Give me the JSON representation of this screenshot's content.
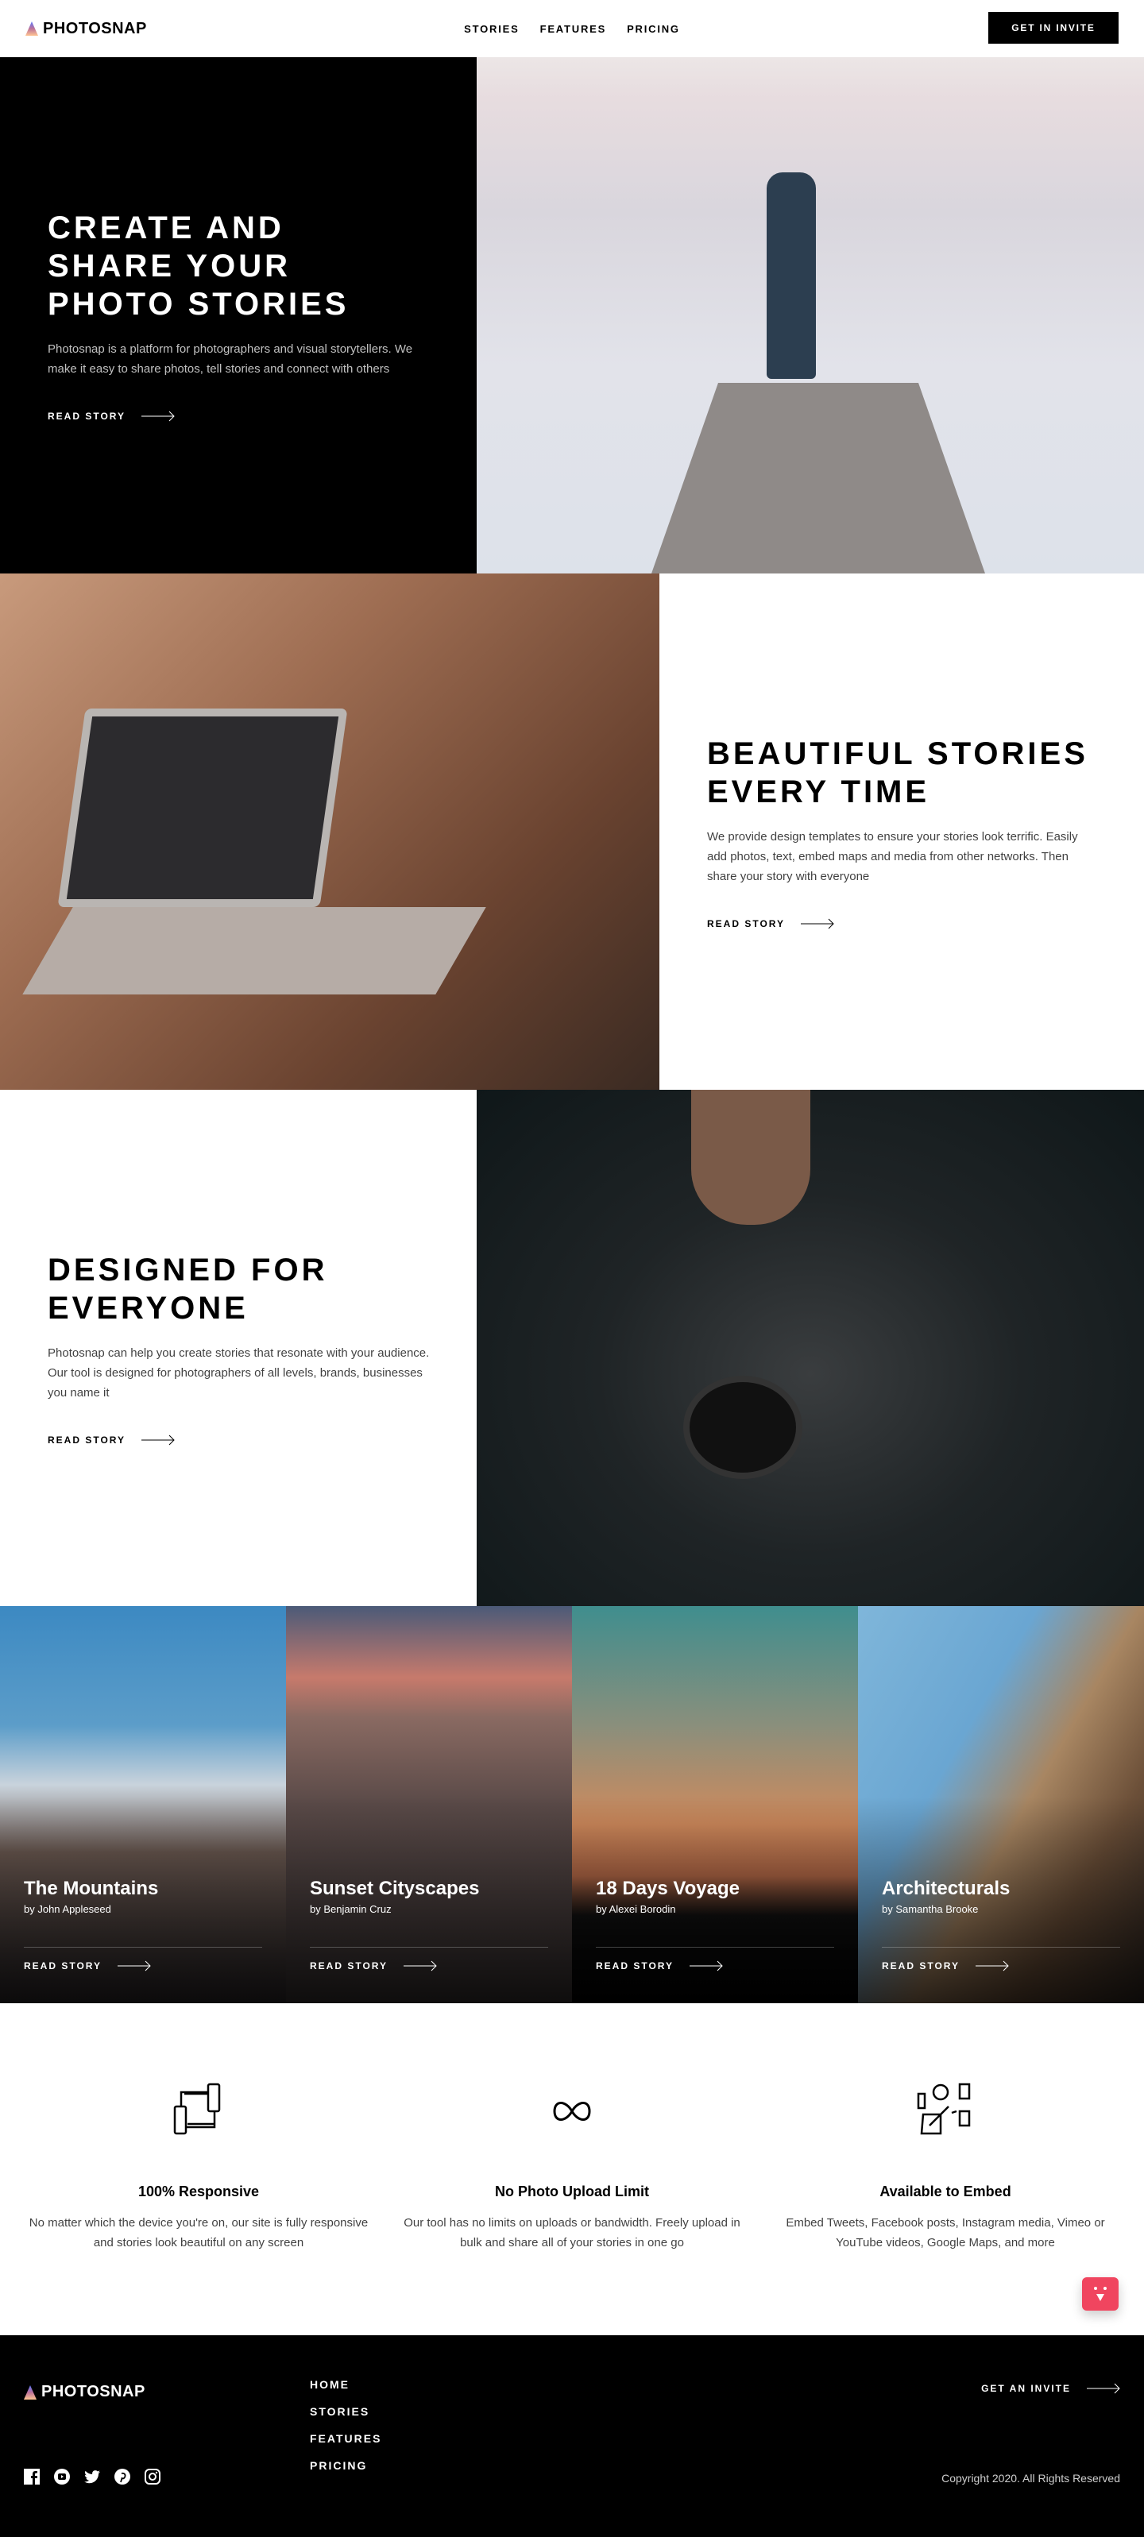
{
  "brand": "PHOTOSNAP",
  "nav": {
    "items": [
      "STORIES",
      "FEATURES",
      "PRICING"
    ],
    "cta": "GET IN INVITE"
  },
  "sections": [
    {
      "title": "CREATE AND SHARE YOUR PHOTO STORIES",
      "text": "Photosnap is a platform for photographers and visual storytellers. We make it easy to share photos, tell stories and connect with others",
      "link": "READ STORY"
    },
    {
      "title": "BEAUTIFUL STORIES EVERY TIME",
      "text": "We provide design templates to ensure your stories look terrific. Easily add photos, text, embed maps and media from other networks. Then share your story with everyone",
      "link": "READ STORY"
    },
    {
      "title": "DESIGNED FOR EVERYONE",
      "text": "Photosnap can help you create stories that resonate with your audience. Our tool is designed for photographers of all levels, brands, businesses you name it",
      "link": "READ STORY"
    }
  ],
  "stories": [
    {
      "title": "The Mountains",
      "author": "by John Appleseed",
      "link": "READ STORY"
    },
    {
      "title": "Sunset Cityscapes",
      "author": "by Benjamin Cruz",
      "link": "READ STORY"
    },
    {
      "title": "18 Days Voyage",
      "author": "by Alexei Borodin",
      "link": "READ STORY"
    },
    {
      "title": "Architecturals",
      "author": "by Samantha Brooke",
      "link": "READ STORY"
    }
  ],
  "features": [
    {
      "icon": "responsive-devices-icon",
      "title": "100% Responsive",
      "text": "No matter which the device you're on, our site is fully responsive and stories look beautiful on any screen"
    },
    {
      "icon": "infinity-icon",
      "title": "No Photo Upload Limit",
      "text": "Our tool has no limits on uploads or bandwidth. Freely upload in bulk and share all of your stories in one go"
    },
    {
      "icon": "embed-media-icon",
      "title": "Available to Embed",
      "text": "Embed Tweets, Facebook posts, Instagram media, Vimeo or YouTube videos, Google Maps, and more"
    }
  ],
  "footer": {
    "nav": [
      "HOME",
      "STORIES",
      "FEATURES",
      "PRICING"
    ],
    "cta": "GET AN INVITE",
    "copyright": "Copyright 2020. All Rights Reserved",
    "social": [
      "facebook-icon",
      "youtube-icon",
      "twitter-icon",
      "pinterest-icon",
      "instagram-icon"
    ]
  },
  "colors": {
    "accent_gradient": [
      "#ffc593",
      "#bc7198",
      "#5a77ff"
    ],
    "chat": "#f0455f"
  }
}
